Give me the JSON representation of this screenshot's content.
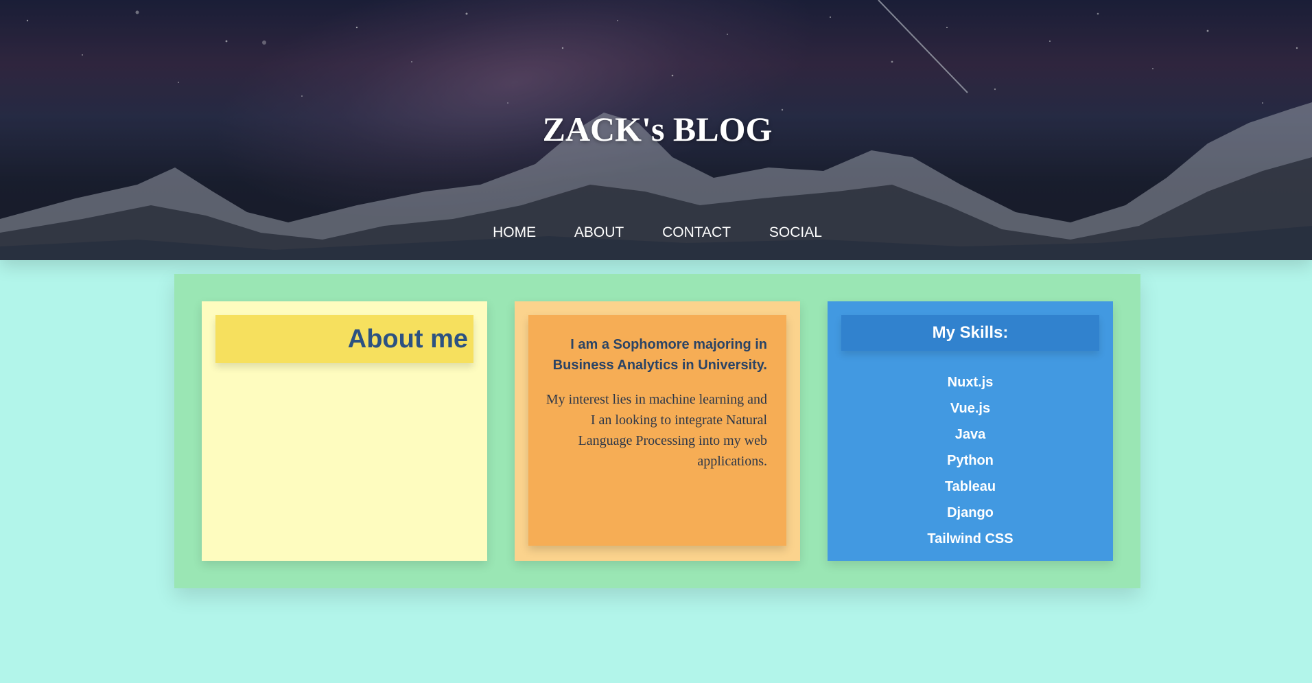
{
  "header": {
    "title": "ZACK's BLOG",
    "background": "night sky with milky way over snowy mountains"
  },
  "nav": {
    "items": [
      {
        "label": "HOME"
      },
      {
        "label": "ABOUT"
      },
      {
        "label": "CONTACT"
      },
      {
        "label": "SOCIAL"
      }
    ]
  },
  "about": {
    "heading": "About me"
  },
  "bio": {
    "lead": "I am a Sophomore majoring in Business Analytics in University.",
    "text": "My interest lies in machine learning and I an looking to integrate Natural Language Processing into my web applications."
  },
  "skills": {
    "heading": "My Skills:",
    "items": [
      "Nuxt.js",
      "Vue.js",
      "Java",
      "Python",
      "Tableau",
      "Django",
      "Tailwind CSS"
    ]
  },
  "colors": {
    "page_bg": "#b2f5ea",
    "board_bg": "#9ae6b4",
    "about_card": "#fefcbf",
    "about_header": "#f6e05e",
    "bio_card": "#fbd38d",
    "bio_inner": "#f6ad55",
    "skills_card": "#4299e1",
    "skills_header": "#3182ce",
    "heading_text": "#2c5282"
  }
}
